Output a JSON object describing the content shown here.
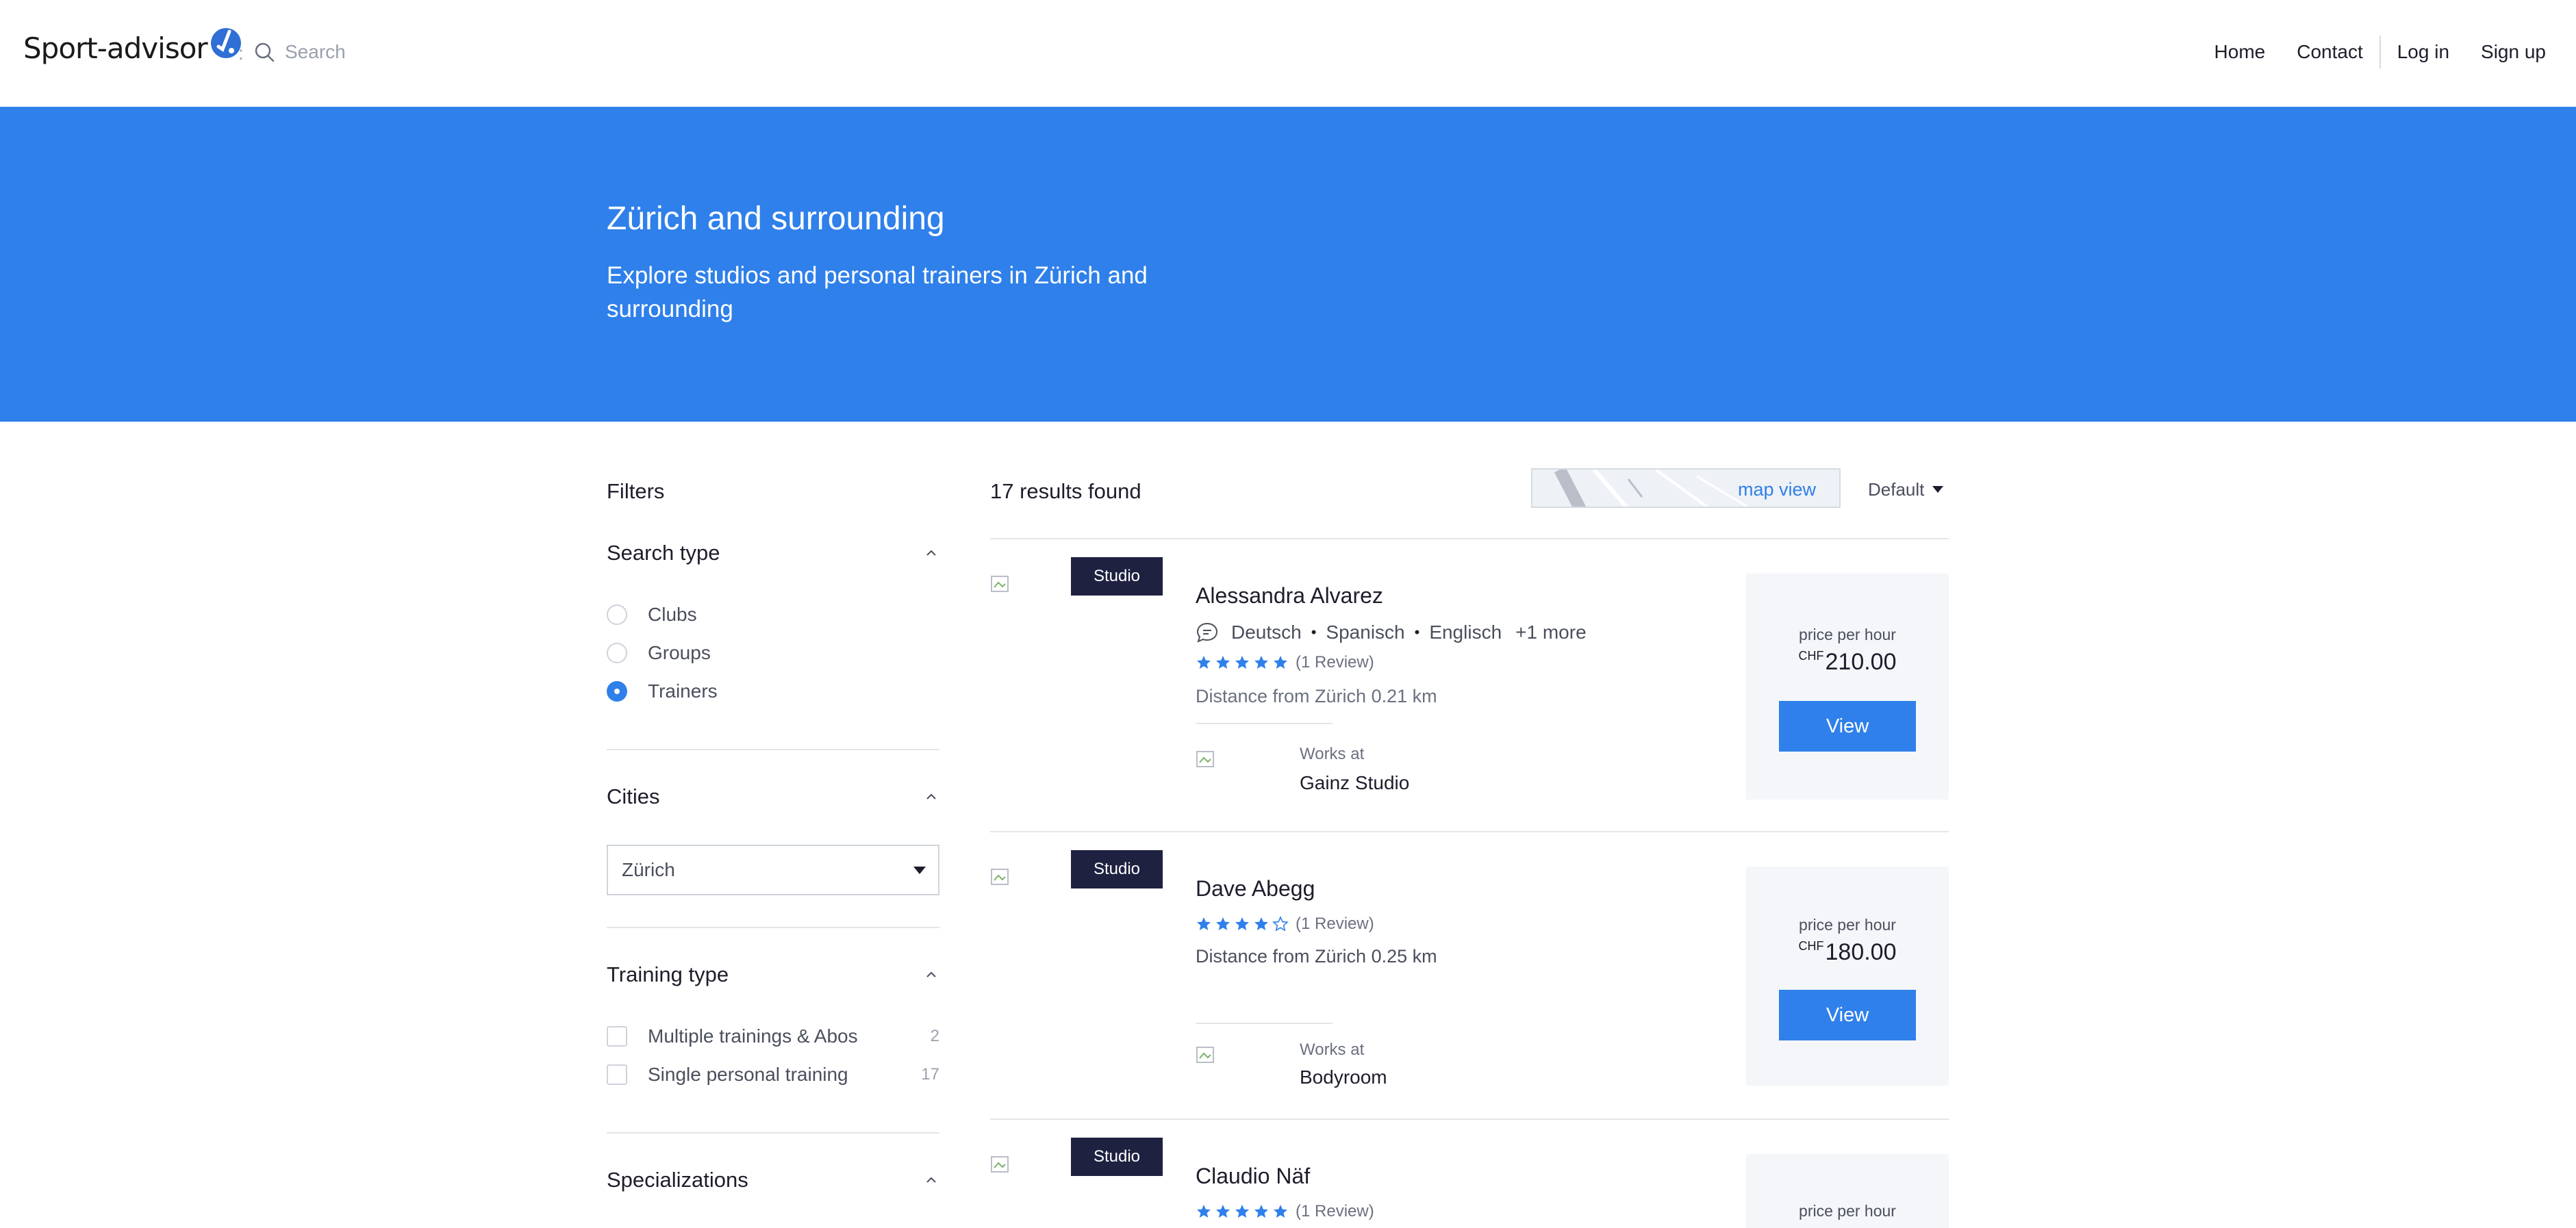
{
  "header": {
    "logo_text": "Sport-advisor",
    "search_placeholder": "Search",
    "nav": {
      "home": "Home",
      "contact": "Contact",
      "login": "Log in",
      "signup": "Sign up"
    }
  },
  "hero": {
    "title": "Zürich and surrounding",
    "subtitle": "Explore studios and personal trainers in Zürich and surrounding"
  },
  "filters": {
    "title": "Filters",
    "search_type": {
      "title": "Search type",
      "options": [
        {
          "label": "Clubs",
          "checked": false
        },
        {
          "label": "Groups",
          "checked": false
        },
        {
          "label": "Trainers",
          "checked": true
        }
      ]
    },
    "cities": {
      "title": "Cities",
      "selected": "Zürich"
    },
    "training_type": {
      "title": "Training type",
      "options": [
        {
          "label": "Multiple trainings & Abos",
          "count": "2"
        },
        {
          "label": "Single personal training",
          "count": "17"
        }
      ]
    },
    "specializations": {
      "title": "Specializations"
    }
  },
  "results": {
    "count_text": "17 results found",
    "map_view_label": "map view",
    "sort_label": "Default",
    "items": [
      {
        "tag": "Studio",
        "name": "Alessandra Alvarez",
        "languages": [
          "Deutsch",
          "Spanisch",
          "Englisch"
        ],
        "languages_more": "+1 more",
        "rating": 5,
        "reviews": "(1 Review)",
        "distance": "Distance from Zürich 0.21 km",
        "works_at_label": "Works at",
        "works_at": "Gainz Studio",
        "price_label": "price per hour",
        "currency": "CHF",
        "price": "210.00",
        "button": "View"
      },
      {
        "tag": "Studio",
        "name": "Dave Abegg",
        "rating": 4,
        "reviews": "(1 Review)",
        "distance": "Distance from Zürich 0.25 km",
        "works_at_label": "Works at",
        "works_at": "Bodyroom",
        "price_label": "price per hour",
        "currency": "CHF",
        "price": "180.00",
        "button": "View"
      },
      {
        "tag": "Studio",
        "name": "Claudio Näf",
        "rating": 5,
        "reviews": "(1 Review)",
        "price_label": "price per hour"
      }
    ]
  },
  "colors": {
    "primary": "#2f80ea",
    "tag_bg": "#1e2140",
    "price_bg": "#f4f6f9",
    "divider": "#e3e5e9"
  }
}
